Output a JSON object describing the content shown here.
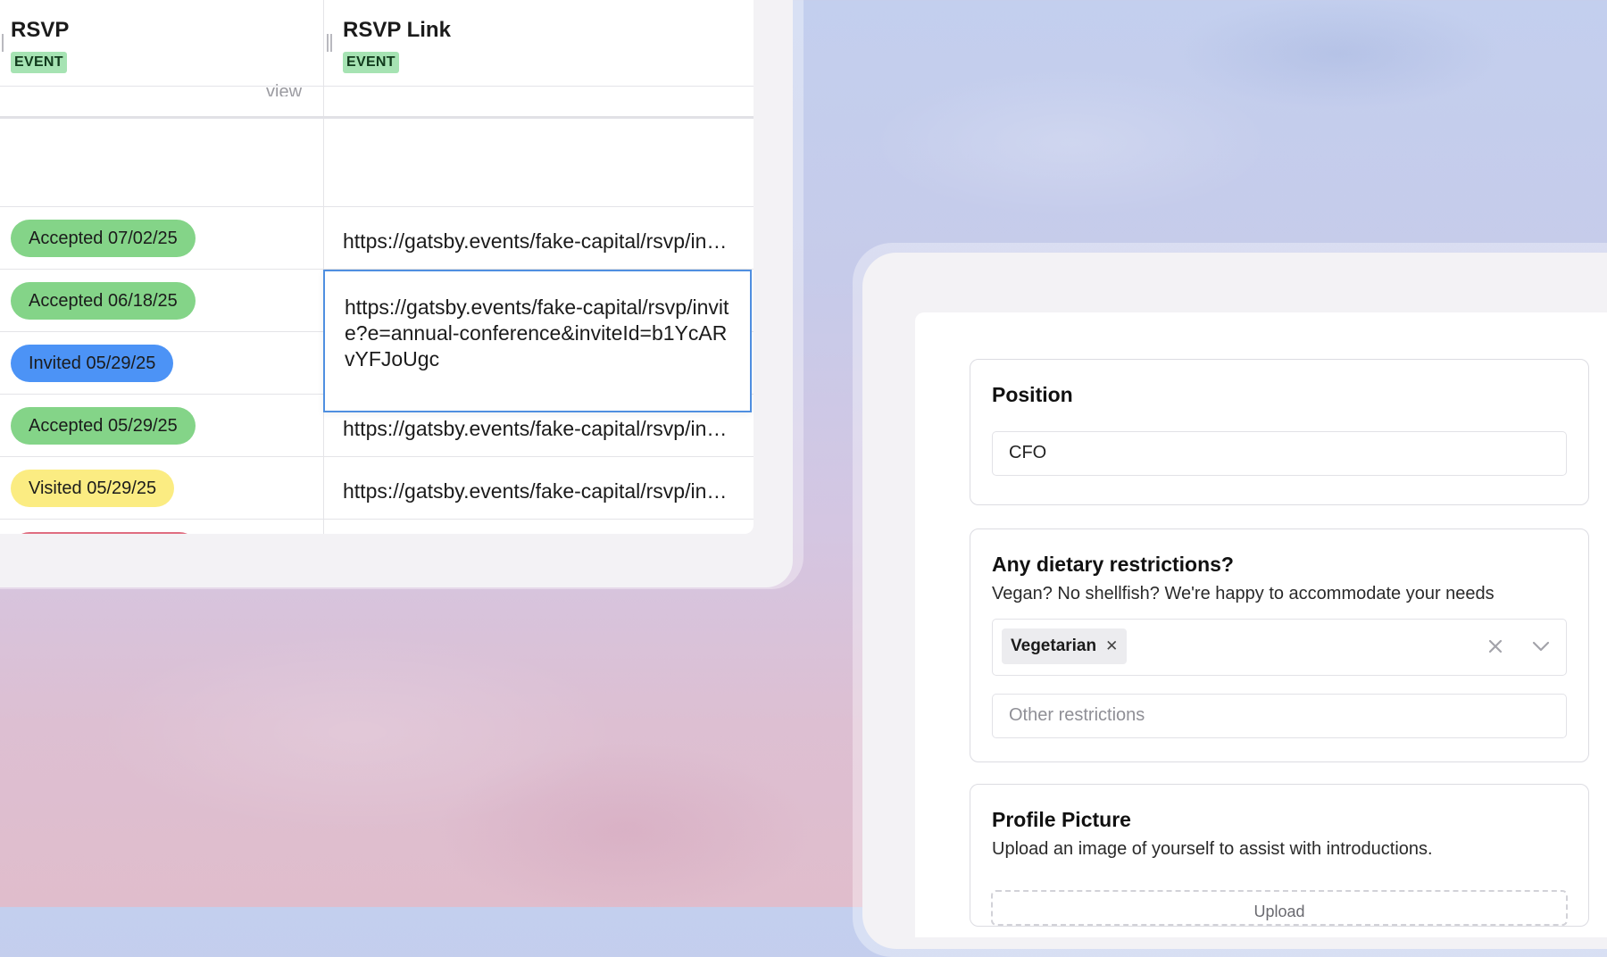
{
  "table": {
    "columns": [
      {
        "title": "RSVP",
        "tag": "EVENT"
      },
      {
        "title": "RSVP Link",
        "tag": "EVENT"
      }
    ],
    "partial_view_text": "view",
    "rows": [
      {
        "status": "Accepted 07/02/25",
        "kind": "accepted",
        "link": "https://gatsby.events/fake-capital/rsvp/invite?e=annual-conference"
      },
      {
        "status": "Accepted 06/18/25",
        "kind": "accepted",
        "link": ""
      },
      {
        "status": "Invited 05/29/25",
        "kind": "invited",
        "link": ""
      },
      {
        "status": "Accepted 05/29/25",
        "kind": "accepted",
        "link": "https://gatsby.events/fake-capital/rsvp/invite?e=annual-conference"
      },
      {
        "status": "Visited 05/29/25",
        "kind": "visited",
        "link": "https://gatsby.events/fake-capital/rsvp/invite?e=annual-conference"
      }
    ],
    "editing_link": "https://gatsby.events/fake-capital/rsvp/invite?e=annual-conference&inviteId=b1YcARvYFJoUgc"
  },
  "form": {
    "position": {
      "label": "Position",
      "value": "CFO"
    },
    "dietary": {
      "label": "Any dietary restrictions?",
      "description": "Vegan? No shellfish? We're happy to accommodate your needs",
      "selected": [
        "Vegetarian"
      ],
      "other_placeholder": "Other restrictions"
    },
    "profile_picture": {
      "label": "Profile Picture",
      "description": "Upload an image of yourself to assist with introductions.",
      "upload_label": "Upload"
    }
  },
  "icons": {
    "remove_chip": "close-icon",
    "clear": "close-icon",
    "dropdown": "chevron-down-icon"
  },
  "colors": {
    "accepted": "#84d488",
    "invited": "#4c93f6",
    "visited": "#fbec82",
    "tag": "#a6e3b3",
    "focus": "#4f8fe0"
  }
}
